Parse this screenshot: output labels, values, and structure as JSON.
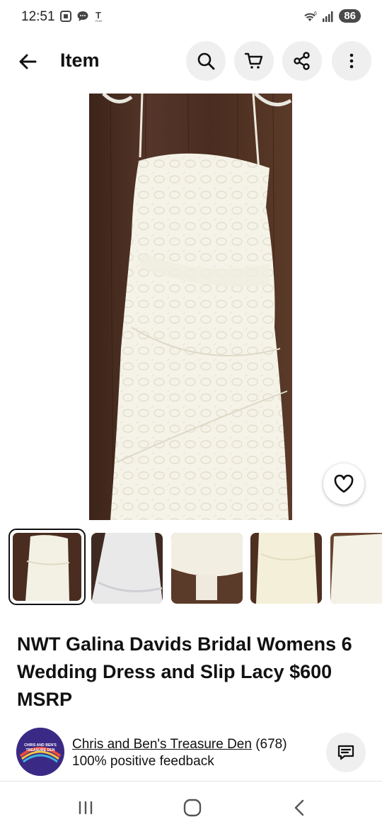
{
  "status_bar": {
    "time": "12:51",
    "battery": "86",
    "icons": [
      "screenshot-icon",
      "chat-bubble-icon",
      "t-mobile-play-icon",
      "wifi-icon",
      "signal-icon"
    ]
  },
  "header": {
    "title": "Item",
    "actions": [
      "search-icon",
      "cart-icon",
      "share-icon",
      "more-icon"
    ]
  },
  "gallery": {
    "thumbnail_count": 5,
    "selected_index": 0
  },
  "item": {
    "title": "NWT Galina Davids Bridal Womens 6 Wedding Dress and Slip Lacy $600 MSRP"
  },
  "seller": {
    "name": "Chris and Ben's Treasure Den",
    "rating_count": "(678)",
    "feedback": "100% positive feedback",
    "avatar_text_line1": "CHRIS AND BEN'S",
    "avatar_text_line2": "TREASURE DEN"
  },
  "colors": {
    "accent_bg": "#efefef",
    "text": "#111111",
    "wood": "#4a2c1c",
    "dress": "#f4f2e6"
  }
}
